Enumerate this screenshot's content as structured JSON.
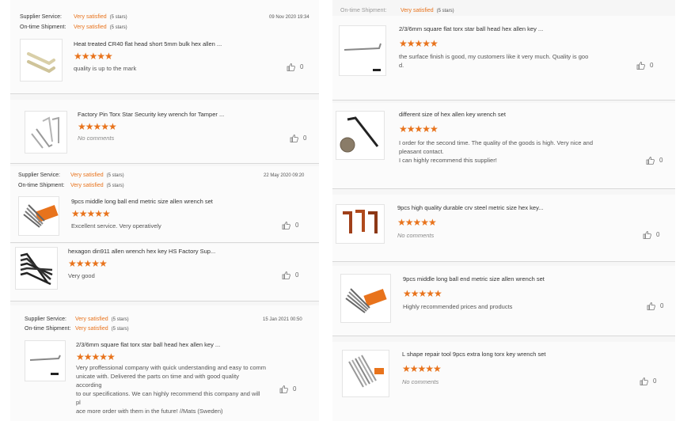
{
  "left": {
    "r1": {
      "supplier_label": "Supplier Service:",
      "supplier_val": "Very satisfied",
      "supplier_stars": "(5 stars)",
      "ontime_label": "On-time Shipment:",
      "ontime_val": "Very satisfied",
      "ontime_stars": "(5 stars)",
      "date": "09 Nov 2020 19:34",
      "title": "Heat treated CR40 flat head short 5mm bulk hex allen ...",
      "text": "quality is up to the mark",
      "likes": "0"
    },
    "r2": {
      "title": "Factory Pin Torx Star Security key wrench for Tamper ...",
      "text": "No comments",
      "likes": "0"
    },
    "r3": {
      "supplier_label": "Supplier Service:",
      "supplier_val": "Very satisfied",
      "supplier_stars": "(5 stars)",
      "ontime_label": "On-time Shipment:",
      "ontime_val": "Very satisfied",
      "ontime_stars": "(5 stars)",
      "date": "22 May 2020 09:20",
      "title": "9pcs middle long ball end metric size allen wrench set",
      "text": "Excellent service. Very operatively",
      "likes": "0"
    },
    "r4": {
      "title": "hexagon din911 allen wrench hex key HS Factory Sup...",
      "text": "Very good",
      "likes": "0"
    },
    "r5": {
      "supplier_label": "Supplier Service:",
      "supplier_val": "Very satisfied",
      "supplier_stars": "(5 stars)",
      "ontime_label": "On-time Shipment:",
      "ontime_val": "Very satisfied",
      "ontime_stars": "(5 stars)",
      "date": "15 Jan 2021 00:50",
      "title": "2/3/6mm square flat torx star ball head hex allen key ...",
      "text_lines": [
        "Very proffessional company with quick understanding and easy to comm",
        "unicate with. Delivered the parts on time and with good quality according",
        "to our specifications. We can highly recommend this company and will pl",
        "ace more order with them in the future! //Mats (Sweden)"
      ],
      "likes": "0"
    }
  },
  "right": {
    "r0": {
      "partial_label": "On-time Shipment:",
      "partial_val": "Very satisfied",
      "partial_stars": "(5 stars)"
    },
    "r1": {
      "title": "2/3/6mm square flat torx star ball head hex allen key ...",
      "text_lines": [
        "the surface finish is good, my customers like it very much. Quality is goo",
        "d."
      ],
      "likes": "0"
    },
    "r2": {
      "title": "different size of hex allen key wrench set",
      "text_lines": [
        "I order for the second time. The quality of the goods is high. Very nice and",
        "pleasant contact.",
        "I can highly recommend this supplier!"
      ],
      "likes": "0"
    },
    "r3": {
      "title": "9pcs high quality durable crv steel metric size hex key...",
      "text": "No comments",
      "likes": "0"
    },
    "r4": {
      "title": "9pcs middle long ball end metric size allen wrench set",
      "text": "Highly recommended prices and products",
      "likes": "0"
    },
    "r5": {
      "title": "L shape repair tool 9pcs extra long torx key wrench set",
      "text": "No comments",
      "likes": "0"
    }
  },
  "rating_stars": "★★★★★",
  "colors": {
    "accent": "#e8731c",
    "text": "#333333",
    "muted": "#888888"
  },
  "icons": {
    "like": "thumbs-up-icon"
  }
}
